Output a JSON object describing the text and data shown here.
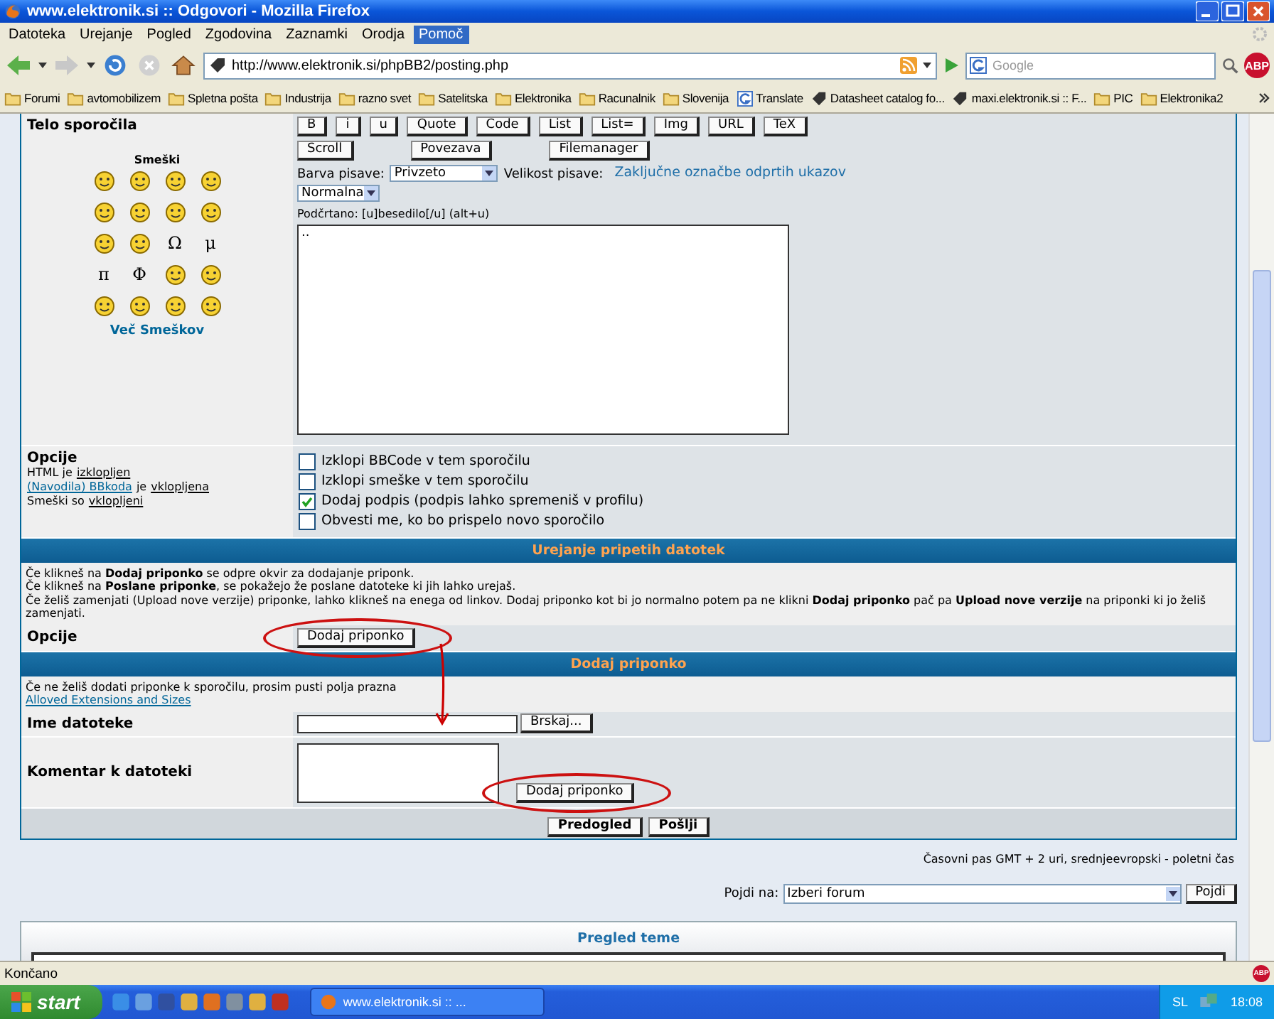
{
  "window": {
    "title": "www.elektronik.si :: Odgovori - Mozilla Firefox"
  },
  "menu": [
    {
      "label": "Datoteka",
      "selected": false
    },
    {
      "label": "Urejanje",
      "selected": false
    },
    {
      "label": "Pogled",
      "selected": false
    },
    {
      "label": "Zgodovina",
      "selected": false
    },
    {
      "label": "Zaznamki",
      "selected": false
    },
    {
      "label": "Orodja",
      "selected": false
    },
    {
      "label": "Pomoč",
      "selected": true
    }
  ],
  "nav": {
    "url": "http://www.elektronik.si/phpBB2/posting.php",
    "search_placeholder": "Google",
    "adblock": "ABP"
  },
  "bookmarks": [
    {
      "label": "Forumi",
      "kind": "folder"
    },
    {
      "label": "avtomobilizem",
      "kind": "folder"
    },
    {
      "label": "Spletna pošta",
      "kind": "folder"
    },
    {
      "label": "Industrija",
      "kind": "folder"
    },
    {
      "label": "razno svet",
      "kind": "folder"
    },
    {
      "label": "Satelitska",
      "kind": "folder"
    },
    {
      "label": "Elektronika",
      "kind": "folder"
    },
    {
      "label": "Racunalnik",
      "kind": "folder"
    },
    {
      "label": "Slovenija",
      "kind": "folder"
    },
    {
      "label": "Translate",
      "kind": "google"
    },
    {
      "label": "Datasheet catalog fo...",
      "kind": "tag"
    },
    {
      "label": "maxi.elektronik.si :: F...",
      "kind": "tag"
    },
    {
      "label": "PIC",
      "kind": "folder"
    },
    {
      "label": "Elektronika2",
      "kind": "folder"
    }
  ],
  "post": {
    "label": "Telo sporočila",
    "smilies_title": "Smeški",
    "smilies": [
      {
        "kind": "face"
      },
      {
        "kind": "face"
      },
      {
        "kind": "face"
      },
      {
        "kind": "face"
      },
      {
        "kind": "face"
      },
      {
        "kind": "face"
      },
      {
        "kind": "face"
      },
      {
        "kind": "face"
      },
      {
        "kind": "face"
      },
      {
        "kind": "face"
      },
      {
        "kind": "symbol",
        "text": "Ω"
      },
      {
        "kind": "symbol",
        "text": "μ"
      },
      {
        "kind": "symbol",
        "text": "π"
      },
      {
        "kind": "symbol",
        "text": "Φ"
      },
      {
        "kind": "face"
      },
      {
        "kind": "face"
      },
      {
        "kind": "face"
      },
      {
        "kind": "face"
      },
      {
        "kind": "face"
      },
      {
        "kind": "face"
      }
    ],
    "more_smilies": "Več Smeškov",
    "format_buttons": [
      [
        "B",
        "i",
        "u",
        "Quote",
        "Code",
        "List",
        "List=",
        "Img",
        "URL",
        "TeX"
      ],
      [
        "Scroll",
        "Povezava",
        "Filemanager"
      ]
    ],
    "color_label": "Barva pisave:",
    "color_value": "Privzeto",
    "size_label": "Velikost pisave:",
    "size_value": "Normalna",
    "close_tags": "Zaključne označbe odprtih ukazov",
    "hint": "Podčrtano: [u]besedilo[/u]  (alt+u)",
    "message": ".."
  },
  "options": {
    "label": "Opcije",
    "status_lines": [
      [
        {
          "kind": "text",
          "text": "HTML je"
        },
        {
          "kind": "state",
          "text": "izklopljen"
        }
      ],
      [
        {
          "kind": "help",
          "text": "(Navodila) BBkoda"
        },
        {
          "kind": "text",
          "text": "je"
        },
        {
          "kind": "state",
          "text": "vklopljena"
        }
      ],
      [
        {
          "kind": "text",
          "text": "Smeški so"
        },
        {
          "kind": "state",
          "text": "vklopljeni"
        }
      ]
    ],
    "checkboxes": [
      {
        "label": "Izklopi BBCode v tem sporočilu",
        "checked": false
      },
      {
        "label": "Izklopi smeške v tem sporočilu",
        "checked": false
      },
      {
        "label": "Dodaj podpis (podpis lahko spremeniš v profilu)",
        "checked": true
      },
      {
        "label": "Obvesti me, ko bo prispelo novo sporočilo",
        "checked": false
      }
    ]
  },
  "attachments": {
    "header": "Urejanje pripetih datotek",
    "info": [
      "Če klikneš na **Dodaj priponko** se odpre okvir za dodajanje priponk.",
      "Če klikneš na **Poslane priponke**, se pokažejo že poslane datoteke ki jih lahko urejaš.",
      "Če želiš zamenjati (Upload nove verzije) priponke, lahko klikneš na enega od linkov. Dodaj priponko kot bi jo normalno potem pa ne klikni **Dodaj priponko** pač pa **Upload nove verzije** na priponki ki jo želiš zamenjati."
    ],
    "options_label": "Opcije",
    "button": "Dodaj priponko"
  },
  "add_attachment": {
    "header": "Dodaj priponko",
    "info": "Če ne želiš dodati priponke k sporočilu, prosim pusti polja prazna",
    "link": "Alloved Extensions and Sizes",
    "file_label": "Ime datoteke",
    "browse": "Brskaj...",
    "comment_label": "Komentar k datoteki",
    "button": "Dodaj priponko"
  },
  "actions": [
    "Predogled",
    "Pošlji"
  ],
  "timezone": "Časovni pas GMT + 2 uri, srednjeevropski - poletni čas",
  "jump": {
    "label": "Pojdi na:",
    "value": "Izberi forum",
    "button": "Pojdi"
  },
  "review": {
    "title": "Pregled teme"
  },
  "status_bar": {
    "text": "Končano",
    "adblock": "ABP"
  },
  "taskbar": {
    "start": "start",
    "task": "www.elektronik.si :: ...",
    "language": "SL",
    "time": "18:08"
  }
}
